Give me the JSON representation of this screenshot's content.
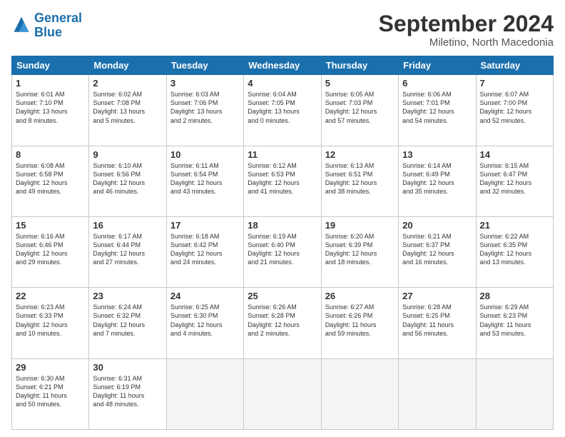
{
  "logo": {
    "line1": "General",
    "line2": "Blue"
  },
  "title": "September 2024",
  "location": "Miletino, North Macedonia",
  "days_of_week": [
    "Sunday",
    "Monday",
    "Tuesday",
    "Wednesday",
    "Thursday",
    "Friday",
    "Saturday"
  ],
  "weeks": [
    [
      {
        "num": "1",
        "detail": "Sunrise: 6:01 AM\nSunset: 7:10 PM\nDaylight: 13 hours\nand 8 minutes."
      },
      {
        "num": "2",
        "detail": "Sunrise: 6:02 AM\nSunset: 7:08 PM\nDaylight: 13 hours\nand 5 minutes."
      },
      {
        "num": "3",
        "detail": "Sunrise: 6:03 AM\nSunset: 7:06 PM\nDaylight: 13 hours\nand 2 minutes."
      },
      {
        "num": "4",
        "detail": "Sunrise: 6:04 AM\nSunset: 7:05 PM\nDaylight: 13 hours\nand 0 minutes."
      },
      {
        "num": "5",
        "detail": "Sunrise: 6:05 AM\nSunset: 7:03 PM\nDaylight: 12 hours\nand 57 minutes."
      },
      {
        "num": "6",
        "detail": "Sunrise: 6:06 AM\nSunset: 7:01 PM\nDaylight: 12 hours\nand 54 minutes."
      },
      {
        "num": "7",
        "detail": "Sunrise: 6:07 AM\nSunset: 7:00 PM\nDaylight: 12 hours\nand 52 minutes."
      }
    ],
    [
      {
        "num": "8",
        "detail": "Sunrise: 6:08 AM\nSunset: 6:58 PM\nDaylight: 12 hours\nand 49 minutes."
      },
      {
        "num": "9",
        "detail": "Sunrise: 6:10 AM\nSunset: 6:56 PM\nDaylight: 12 hours\nand 46 minutes."
      },
      {
        "num": "10",
        "detail": "Sunrise: 6:11 AM\nSunset: 6:54 PM\nDaylight: 12 hours\nand 43 minutes."
      },
      {
        "num": "11",
        "detail": "Sunrise: 6:12 AM\nSunset: 6:53 PM\nDaylight: 12 hours\nand 41 minutes."
      },
      {
        "num": "12",
        "detail": "Sunrise: 6:13 AM\nSunset: 6:51 PM\nDaylight: 12 hours\nand 38 minutes."
      },
      {
        "num": "13",
        "detail": "Sunrise: 6:14 AM\nSunset: 6:49 PM\nDaylight: 12 hours\nand 35 minutes."
      },
      {
        "num": "14",
        "detail": "Sunrise: 6:15 AM\nSunset: 6:47 PM\nDaylight: 12 hours\nand 32 minutes."
      }
    ],
    [
      {
        "num": "15",
        "detail": "Sunrise: 6:16 AM\nSunset: 6:46 PM\nDaylight: 12 hours\nand 29 minutes."
      },
      {
        "num": "16",
        "detail": "Sunrise: 6:17 AM\nSunset: 6:44 PM\nDaylight: 12 hours\nand 27 minutes."
      },
      {
        "num": "17",
        "detail": "Sunrise: 6:18 AM\nSunset: 6:42 PM\nDaylight: 12 hours\nand 24 minutes."
      },
      {
        "num": "18",
        "detail": "Sunrise: 6:19 AM\nSunset: 6:40 PM\nDaylight: 12 hours\nand 21 minutes."
      },
      {
        "num": "19",
        "detail": "Sunrise: 6:20 AM\nSunset: 6:39 PM\nDaylight: 12 hours\nand 18 minutes."
      },
      {
        "num": "20",
        "detail": "Sunrise: 6:21 AM\nSunset: 6:37 PM\nDaylight: 12 hours\nand 16 minutes."
      },
      {
        "num": "21",
        "detail": "Sunrise: 6:22 AM\nSunset: 6:35 PM\nDaylight: 12 hours\nand 13 minutes."
      }
    ],
    [
      {
        "num": "22",
        "detail": "Sunrise: 6:23 AM\nSunset: 6:33 PM\nDaylight: 12 hours\nand 10 minutes."
      },
      {
        "num": "23",
        "detail": "Sunrise: 6:24 AM\nSunset: 6:32 PM\nDaylight: 12 hours\nand 7 minutes."
      },
      {
        "num": "24",
        "detail": "Sunrise: 6:25 AM\nSunset: 6:30 PM\nDaylight: 12 hours\nand 4 minutes."
      },
      {
        "num": "25",
        "detail": "Sunrise: 6:26 AM\nSunset: 6:28 PM\nDaylight: 12 hours\nand 2 minutes."
      },
      {
        "num": "26",
        "detail": "Sunrise: 6:27 AM\nSunset: 6:26 PM\nDaylight: 11 hours\nand 59 minutes."
      },
      {
        "num": "27",
        "detail": "Sunrise: 6:28 AM\nSunset: 6:25 PM\nDaylight: 11 hours\nand 56 minutes."
      },
      {
        "num": "28",
        "detail": "Sunrise: 6:29 AM\nSunset: 6:23 PM\nDaylight: 11 hours\nand 53 minutes."
      }
    ],
    [
      {
        "num": "29",
        "detail": "Sunrise: 6:30 AM\nSunset: 6:21 PM\nDaylight: 11 hours\nand 50 minutes."
      },
      {
        "num": "30",
        "detail": "Sunrise: 6:31 AM\nSunset: 6:19 PM\nDaylight: 11 hours\nand 48 minutes."
      },
      {
        "num": "",
        "detail": ""
      },
      {
        "num": "",
        "detail": ""
      },
      {
        "num": "",
        "detail": ""
      },
      {
        "num": "",
        "detail": ""
      },
      {
        "num": "",
        "detail": ""
      }
    ]
  ]
}
